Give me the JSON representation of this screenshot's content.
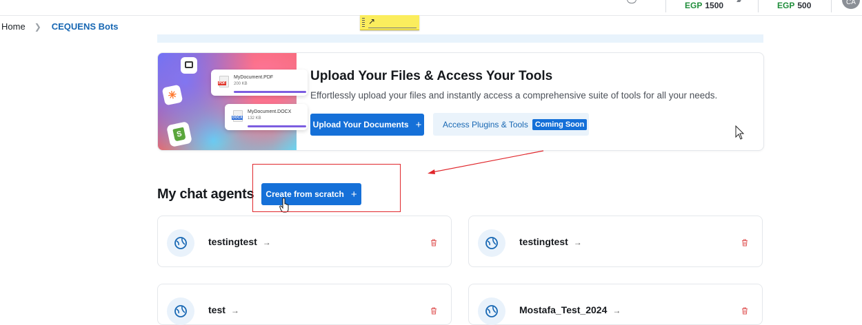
{
  "topbar": {
    "balances": [
      {
        "currency": "EGP",
        "amount": "1500"
      },
      {
        "currency": "EGP",
        "amount": "500"
      }
    ],
    "avatar_initials": "CA"
  },
  "breadcrumb": {
    "home": "Home",
    "current": "CEQUENS Bots"
  },
  "sticky_note": {
    "symbol": "↗"
  },
  "upload": {
    "title": "Upload Your Files & Access Your Tools",
    "subtitle": "Effortlessly upload your files and instantly access a comprehensive suite of tools for all your needs.",
    "upload_button": "Upload Your Documents",
    "plugins_label": "Access Plugins & Tools",
    "coming_soon": "Coming Soon",
    "docs": [
      {
        "name": "MyDocument.PDF",
        "size": "200 KB",
        "tag": "PDF",
        "tag_color": "#e0352b"
      },
      {
        "name": "MyDocument.DOCX",
        "size": "132 KB",
        "tag": "DOCX",
        "tag_color": "#2b6bd6"
      }
    ]
  },
  "agents": {
    "title": "My chat agents",
    "create_button": "Create from scratch",
    "items": [
      {
        "name": "testingtest"
      },
      {
        "name": "testingtest"
      },
      {
        "name": "test"
      },
      {
        "name": "Mostafa_Test_2024"
      }
    ]
  },
  "colors": {
    "primary": "#1570d8",
    "link": "#1767b3",
    "annotation": "#e0262b",
    "balance_green": "#1f8d3a",
    "trash_red": "#e05a5a"
  },
  "icons": {
    "notification": "bell-icon",
    "agent": "globe-chat-icon",
    "delete": "trash-icon",
    "add": "plus-icon"
  }
}
